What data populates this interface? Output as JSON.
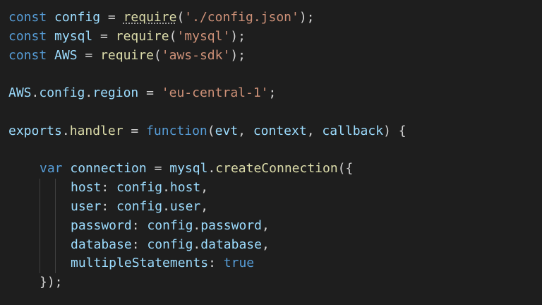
{
  "editor": {
    "colors": {
      "background": "#1e1e1e",
      "keyword": "#569cd6",
      "variable": "#9cdcfe",
      "function": "#dcdcaa",
      "string": "#ce9178",
      "default_text": "#d4d4d4"
    },
    "lines": [
      {
        "t": {
          "kw": "const",
          "sp1": " ",
          "name": "config",
          "eq": " = ",
          "fn": "require",
          "po": "(",
          "str": "'./config.json'",
          "pc": ");"
        }
      },
      {
        "t": {
          "kw": "const",
          "sp1": " ",
          "name": "mysql",
          "eq": " = ",
          "fn": "require",
          "po": "(",
          "str": "'mysql'",
          "pc": ");"
        }
      },
      {
        "t": {
          "kw": "const",
          "sp1": " ",
          "name": "AWS",
          "eq": " = ",
          "fn": "require",
          "po": "(",
          "str": "'aws-sdk'",
          "pc": ");"
        }
      },
      {
        "t": {}
      },
      {
        "t": {
          "obj": "AWS",
          "dot1": ".",
          "p1": "config",
          "dot2": ".",
          "p2": "region",
          "eq": " = ",
          "str": "'eu-central-1'",
          "end": ";"
        }
      },
      {
        "t": {}
      },
      {
        "t": {
          "obj": "exports",
          "dot1": ".",
          "p1": "handler",
          "eq": " = ",
          "kw": "function",
          "po": "(",
          "a1": "evt",
          "c1": ", ",
          "a2": "context",
          "c2": ", ",
          "a3": "callback",
          "pc": ") {"
        }
      },
      {
        "t": {}
      },
      {
        "t": {
          "kw": "var",
          "sp1": " ",
          "name": "connection",
          "eq": " = ",
          "obj": "mysql",
          "dot": ".",
          "fn": "createConnection",
          "po": "({"
        }
      },
      {
        "t": {
          "key": "host",
          "colon": ": ",
          "obj": "config",
          "dot": ".",
          "prop": "host",
          "end": ","
        }
      },
      {
        "t": {
          "key": "user",
          "colon": ": ",
          "obj": "config",
          "dot": ".",
          "prop": "user",
          "end": ","
        }
      },
      {
        "t": {
          "key": "password",
          "colon": ": ",
          "obj": "config",
          "dot": ".",
          "prop": "password",
          "end": ","
        }
      },
      {
        "t": {
          "key": "database",
          "colon": ": ",
          "obj": "config",
          "dot": ".",
          "prop": "database",
          "end": ","
        }
      },
      {
        "t": {
          "key": "multipleStatements",
          "colon": ": ",
          "val": "true"
        }
      },
      {
        "t": {
          "close": "});"
        }
      }
    ]
  }
}
